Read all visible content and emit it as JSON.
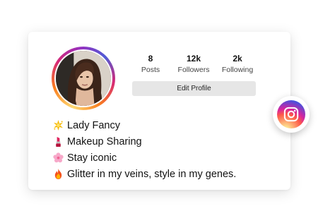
{
  "profile": {
    "stats": [
      {
        "value": "8",
        "label": "Posts"
      },
      {
        "value": "12k",
        "label": "Followers"
      },
      {
        "value": "2k",
        "label": "Following"
      }
    ],
    "edit_button_label": "Edit Profile",
    "bio": [
      {
        "icon": "sparkle-icon",
        "text": "Lady Fancy"
      },
      {
        "icon": "lipstick-icon",
        "text": "Makeup Sharing"
      },
      {
        "icon": "cherry-blossom-icon",
        "text": "Stay iconic"
      },
      {
        "icon": "fire-icon",
        "text": "Glitter in my veins, style in my genes."
      }
    ]
  },
  "badge": {
    "icon": "instagram-logo-icon"
  },
  "colors": {
    "ring_gradient": [
      "#feda75",
      "#fa7e1e",
      "#d62976",
      "#962fbf",
      "#4f5bd5"
    ],
    "button_bg": "#e6e6e6",
    "text": "#111111"
  }
}
